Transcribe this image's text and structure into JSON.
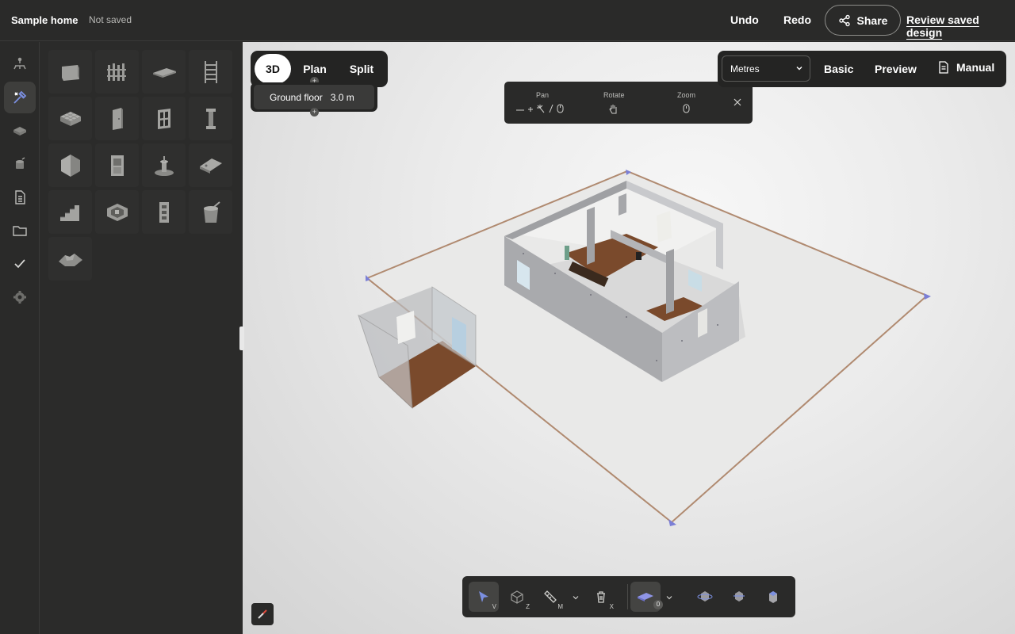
{
  "header": {
    "title": "Sample home",
    "status": "Not saved",
    "undo_label": "Undo",
    "redo_label": "Redo",
    "share_label": "Share",
    "review_label": "Review saved design"
  },
  "rail": {
    "items": [
      "levels-icon",
      "tools-icon",
      "materials-icon",
      "furniture-icon",
      "document-icon",
      "folder-icon",
      "check-icon",
      "settings-icon"
    ],
    "active": "tools-icon"
  },
  "palette": {
    "items": [
      "wall",
      "fence",
      "slab",
      "ladder",
      "grid-panel",
      "door",
      "window",
      "pillar",
      "box-shape",
      "cabinet",
      "fountain",
      "roof",
      "stairs",
      "room-kit",
      "column-block",
      "bucket",
      "terrain"
    ]
  },
  "view_modes": {
    "mode_3d": "3D",
    "mode_plan": "Plan",
    "mode_split": "Split",
    "selected": "3D"
  },
  "floor": {
    "name": "Ground floor",
    "height": "3.0 m"
  },
  "help": {
    "pan_label": "Pan",
    "rotate_label": "Rotate",
    "zoom_label": "Zoom"
  },
  "settings": {
    "units": "Metres",
    "basic_label": "Basic",
    "preview_label": "Preview",
    "manual_label": "Manual"
  },
  "toolbar": {
    "tools": [
      {
        "name": "select-tool",
        "key": "V"
      },
      {
        "name": "box-select-tool",
        "key": "Z"
      },
      {
        "name": "measure-tool",
        "key": "M"
      },
      {
        "name": "delete-tool",
        "key": "X"
      },
      {
        "name": "layer-tool",
        "key": "0"
      }
    ]
  },
  "colors": {
    "accent": "#7b7fd6",
    "panel": "#2a2a29",
    "floor_wood": "#7a4a2c"
  }
}
